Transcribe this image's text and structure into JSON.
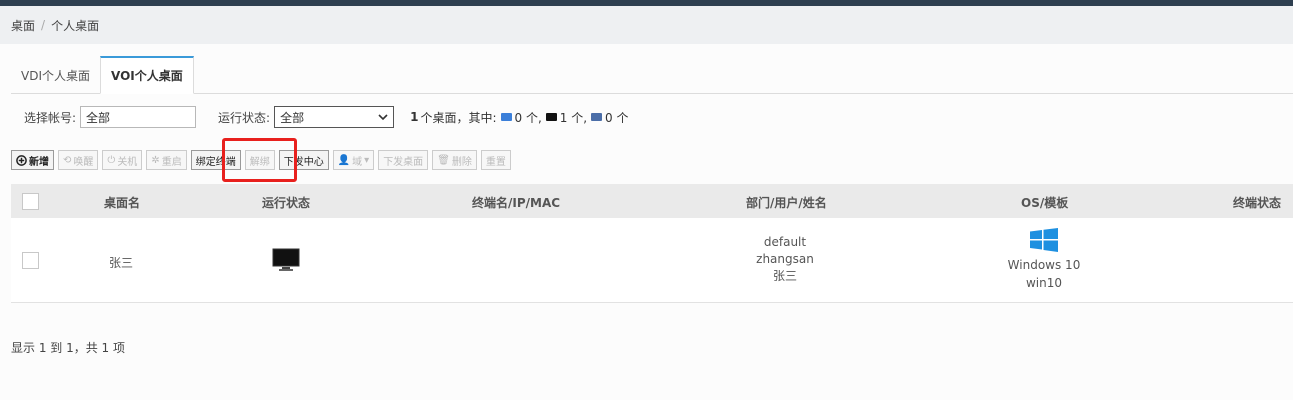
{
  "breadcrumb": {
    "root": "桌面",
    "separator": "/",
    "current": "个人桌面"
  },
  "tabs": [
    {
      "label": "VDI个人桌面"
    },
    {
      "label": "VOI个人桌面"
    }
  ],
  "filters": {
    "account_label": "选择帐号:",
    "account_value": "全部",
    "status_label": "运行状态:",
    "status_value": "全部",
    "summary_total": "1",
    "summary_text": "个桌面，其中:",
    "counts": [
      {
        "count": "0 个,",
        "color": "#3b7fd9"
      },
      {
        "count": "1 个,",
        "color": "#111111"
      },
      {
        "count": "0 个",
        "color": "#4b6ea8"
      }
    ]
  },
  "toolbar": {
    "add": "新增",
    "wake": "唤醒",
    "shutdown": "关机",
    "restart": "重启",
    "bind": "绑定终端",
    "unbind": "解绑",
    "dispatch_center": "下发中心",
    "domain": "域",
    "dispatch_desktop": "下发桌面",
    "delete": "删除",
    "reset": "重置"
  },
  "table": {
    "headers": {
      "name": "桌面名",
      "status": "运行状态",
      "terminal": "终端名/IP/MAC",
      "dept": "部门/用户/姓名",
      "os": "OS/模板",
      "term_status": "终端状态"
    },
    "rows": [
      {
        "name": "张三",
        "status_icon": "monitor-off-icon",
        "dept": "default",
        "user": "zhangsan",
        "fullname": "张三",
        "os_icon": "windows-logo-icon",
        "os": "Windows 10",
        "template": "win10"
      }
    ]
  },
  "footer": {
    "text": "显示 1 到 1，共 1 项"
  },
  "colors": {
    "accent": "#3a9ad9",
    "highlight": "#e8201d",
    "windows": "#1e90e0"
  }
}
